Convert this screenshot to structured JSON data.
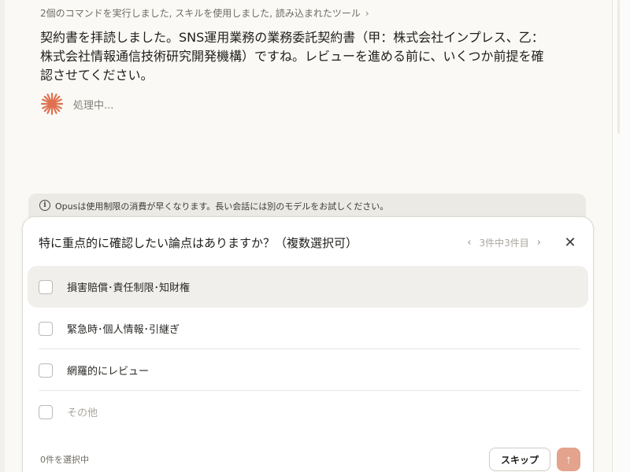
{
  "tools_summary": {
    "text": "2個のコマンドを実行しました, スキルを使用しました, 読み込まれたツール",
    "chevron_icon": "chevron-right-icon"
  },
  "message": {
    "text": "契約書を拝読しました。SNS運用業務の業務委託契約書（甲：株式会社インプレス、乙：株式会社情報通信技術研究開発機構）ですね。レビューを進める前に、いくつか前提を確認させてください。"
  },
  "processing": {
    "label": "処理中...",
    "icon": "spark-icon",
    "color": "#e0714f"
  },
  "notice": {
    "text": "Opusは使用制限の消費が早くなります。長い会話には別のモデルをお試しください。",
    "icon": "info-icon"
  },
  "question_panel": {
    "question": "特に重点的に確認したい論点はありますか？（複数選択可）",
    "pager": {
      "prev_icon": "chevron-left-icon",
      "text": "3件中3件目",
      "next_icon": "chevron-right-icon"
    },
    "close_icon": "close-icon",
    "options": [
      {
        "label": "損害賠償･責任制限･知財権",
        "checked": false
      },
      {
        "label": "緊急時･個人情報･引継ぎ",
        "checked": false
      },
      {
        "label": "網羅的にレビュー",
        "checked": false
      },
      {
        "label": "その他",
        "checked": false
      }
    ],
    "selected_count": "0件を選択中",
    "skip_label": "スキップ",
    "submit_icon": "arrow-up-icon",
    "submit_color": "#e3a38c"
  }
}
